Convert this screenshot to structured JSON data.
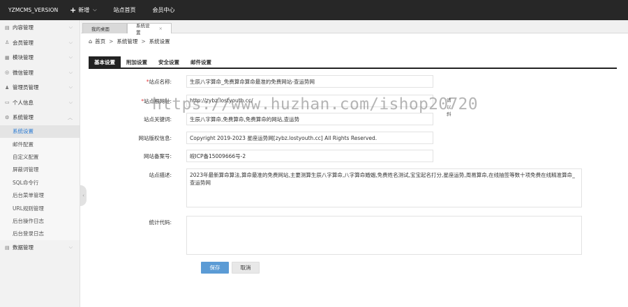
{
  "topbar": {
    "brand": "YZMCMS_VERSION",
    "nav": [
      {
        "label": "新增",
        "plus": "+",
        "caret": "⌵"
      },
      {
        "label": "站点首页"
      },
      {
        "label": "会员中心"
      }
    ]
  },
  "sidebar": {
    "groups": [
      {
        "label": "内容管理",
        "icon": "▤"
      },
      {
        "label": "会员管理",
        "icon": "♙"
      },
      {
        "label": "模块管理",
        "icon": "▦"
      },
      {
        "label": "微信管理",
        "icon": "◎"
      },
      {
        "label": "管理员管理",
        "icon": "♟"
      },
      {
        "label": "个人信息",
        "icon": "▭"
      },
      {
        "label": "系统管理",
        "icon": "⚙"
      }
    ],
    "system_items": [
      "系统设置",
      "邮件配置",
      "自定义配置",
      "屏蔽词管理",
      "SQL命令行",
      "后台菜单管理",
      "URL规则管理",
      "后台操作日志",
      "后台登录日志"
    ],
    "last_group": {
      "label": "数据管理",
      "icon": "▤"
    },
    "chev_down": "⌵",
    "chev_up": "︿",
    "collapse": "‹"
  },
  "tabs": [
    {
      "label": "我的桌面"
    },
    {
      "label": "系统设置",
      "close": "×"
    }
  ],
  "breadcrumb": {
    "home_icon": "⌂",
    "home": "首页",
    "sep": ">",
    "level1": "系统管理",
    "level2": "系统设置"
  },
  "settings_tabs": [
    "基本设置",
    "附加设置",
    "安全设置",
    "邮件设置"
  ],
  "form": {
    "site_name": {
      "label": "站点名称:",
      "value": "生辰八字算命_免费算命算命最准的免费网站-查运势网"
    },
    "site_url": {
      "label": "站点根网址:",
      "value": "http://zybz.lostyouth.cc/",
      "hint": "请以斜"
    },
    "keywords": {
      "label": "站点关键词:",
      "value": "生辰八字算命,免费算命,免费算命的网站,查运势"
    },
    "copyright": {
      "label": "网站版权信息:",
      "value": "Copyright 2019-2023 星座运势网[zybz.lostyouth.cc] All Rights Reserved."
    },
    "icp": {
      "label": "网站备案号:",
      "value": "皖ICP备15009666号-2"
    },
    "description": {
      "label": "站点描述:",
      "value": "2023年最新算命算法,算命最准的免费网站,主要测算生辰八字算命,八字算命婚姻,免费姓名测试,宝宝起名打分,星座运势,周易算命,在线抽签等数十项免费在线精准算命_查运势网"
    },
    "stats": {
      "label": "统计代码:",
      "value": ""
    },
    "required_mark": "*"
  },
  "buttons": {
    "save": "保存",
    "cancel": "取消"
  },
  "watermark": "https://www.huzhan.com/ishop20720"
}
